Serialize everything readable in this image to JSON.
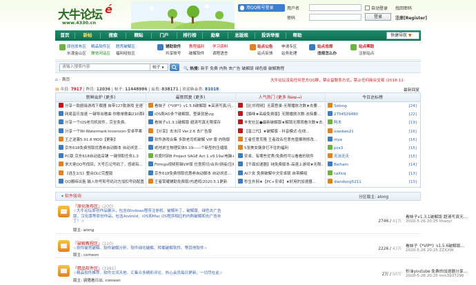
{
  "header": {
    "logo_text": "大牛论坛",
    "logo_sub": "www.4330.cn",
    "qq_login": "用QQ帐号登录",
    "username_label": "用户名",
    "password_label": "密码",
    "autologin_label": "自动登录",
    "find_password": "找回密码",
    "login_button": "登录",
    "register_link": "注册[Register]"
  },
  "nav": {
    "items": [
      "首页",
      "新帖",
      "搜索",
      "精贴",
      "门户",
      "排行榜",
      "勋章",
      "总版规",
      "投诉举报",
      "帮助"
    ],
    "quick_nav": "快捷导航"
  },
  "subnav": {
    "groups": [
      {
        "links": [
          "原创发布区",
          "精品软件区",
          "脱壳破解区"
        ],
        "links2": [
          "水漫金山区",
          "静觉闲话区",
          "福利经验区"
        ]
      },
      {
        "links": [
          "辅助软件",
          "教程福利",
          "学习资料"
        ],
        "links2": [
          "共享账号",
          "破解软件",
          "调程语言"
        ]
      },
      {
        "links": [
          "站点公告",
          "申请专区"
        ],
        "links2": [
          "站点反馈",
          "站务处理"
        ]
      },
      {
        "links": [
          "站点总规",
          "违规怎么办"
        ]
      },
      {
        "links": [
          "站点帮助",
          "注册站点"
        ]
      }
    ]
  },
  "search": {
    "placeholder": "请输入搜索内容",
    "scope": "帖子",
    "hot_label": "热搜:",
    "hot_terms": [
      "新手",
      "免费",
      "内购",
      "去广告",
      "破解版",
      "绿色版",
      "破解教程"
    ]
  },
  "breadcrumb": {
    "home": "首页"
  },
  "announcement": "大牛论坛没有任何官方QQ群，禁止留联系方式，禁止任何商业交易 (2018-12-",
  "stats": {
    "today_label": "今日:",
    "today": "7917",
    "yesterday_label": "昨日:",
    "yesterday": "12036",
    "posts_label": "帖子:",
    "posts": "11448986",
    "members_label": "会员:",
    "members": "838171",
    "newest_label": "欢迎新会员:",
    "newest": "81018"
  },
  "latest_reply": "最新回复",
  "columns": {
    "new": {
      "title": "新鲜出炉 (更多)",
      "rows": [
        "分享一款超级游戏下载器 自带127款游戏 全速下...",
        "网易音乐加速 一键导出歌曲 你歌单歌曲210首破...",
        "分享一个iOS老司机软件，完全免费。",
        "分享一个Wi-Watermark-Inversion-安卓苹果",
        "王之逆袭5.91.8 MOD【更新】",
        "京东618免费领取优惠券自动脚本 自动浏览...",
        "PC版 京东618自动逛店铺 一键领取任务1.3",
        "求大佬QQ号找回，大号忘记号码了，感谢有...",
        "《逃生2/1》整合DLC完整版",
        "QQ搬砖出售 输入你号和号码对方加扣号码配置..."
      ]
    },
    "top": {
      "title": "最新回复 (更多)",
      "rows": [
        "看妹子《*VIP*》v1.5.6破解版 ★高清写真/元...",
        "iOS爬AD多个破解版，登录就是vip",
        "看妹子v1.3.1破解版 超清写真无限保存",
        "【分享】去水印 Ver.2.6 去广告版",
        "软件游戏合集 多款老司机破解 VIP 版 内购版",
        "绝地求生物理实体5.19——个新型的压缩版",
        "欢度时刻8 Project SAGE Act 1 v0.19a(电脑+安卓)",
        "Filmigo视频剪辑VIP版 任意剪切/合并/拼接/压缩",
        "京东618免费领取优惠券自动脚本 自动浏览...",
        "王者荣耀辅助免费版/内透视/2020.5.1更新"
      ]
    },
    "hot": {
      "title": "人气热门 (更多 New→)",
      "rows": [
        "【比邻视频】无需登录-无限播放次数★去要...",
        "【猫咪★高级免费版】无限播放次数-去除要...",
        "羊驼社区●最新破解版★解锁无限观看次数★去...",
        "【富二代】★破解版 - 抖音模式-在线...",
        "王者任意克隆 王者改名任意充值懒得修改...",
        "5张美女健身打不住的福利",
        "安卓、有哪些优秀/免费的可以看看的软件",
        "【千面加速器】纯免费版本-高速上游戏★无限...",
        "AI少女 免费破解中文安卓版 自带模组",
        "秒生外网★【PC+安卓】★好用的加速器..."
      ]
    },
    "rank": {
      "title": "今日达标榜",
      "rows": [
        {
          "name": "Solong",
          "count": "24"
        },
        {
          "name": "2754529480",
          "count": "22"
        },
        {
          "name": "阿木",
          "count": "19"
        },
        {
          "name": "xiaobao21",
          "count": "16"
        },
        {
          "name": "mya",
          "count": "16"
        },
        {
          "name": "pcx3",
          "count": "15"
        },
        {
          "name": "无法无天",
          "count": "15"
        },
        {
          "name": "Beiham",
          "count": "14"
        },
        {
          "name": "callicq",
          "count": "13"
        },
        {
          "name": "diandong5211",
          "count": "13"
        }
      ]
    }
  },
  "forum": {
    "head": "软件版块",
    "moderator": "分区版主: along",
    "rows": [
      {
        "title": "『原创发布区』",
        "count": "(200)",
        "desc": "☆大牛论坛原创作品展示，包含Windows程序注册机、破解补丁、破解版、绿色去广告版、汉化版等原创作品，包含Android、iOS和Mac OS程序相应的内购破解和去广告补丁！☆",
        "mod": "版主: along",
        "threads": "2746",
        "posts": "41万",
        "last_title": "看妹子v1.3.1破解版 超清写真无...",
        "last_meta": "2020-5-26 20:25 lihaoyl"
      },
      {
        "title": "『破解教程区』",
        "count": "(110)",
        "desc": "☆软件破壳破解、软件破解分析、软件绿化破解、转载破解软件、等其他软件☆",
        "mod": "版主: comeon",
        "threads": "2226",
        "posts": "43万",
        "last_title": "看妹子《*VIP*》v1.5.6破解版...",
        "last_meta": "2020-5-26 20:25 ZZXXW"
      },
      {
        "title": "『精品软件区』",
        "count": "(1981)",
        "desc": "☆精品软件推荐、软件交流天地、汇集众多精彩评论、热心会员每日更新，一切尽在此☆",
        "mod": "版主: 骑猪看日出, comeon",
        "threads": "2万",
        "posts": "50万",
        "last_title": "秒油youtube 免费的加速器分享...",
        "last_meta": "2020-5-26 20:25 mm3937296"
      }
    ]
  }
}
